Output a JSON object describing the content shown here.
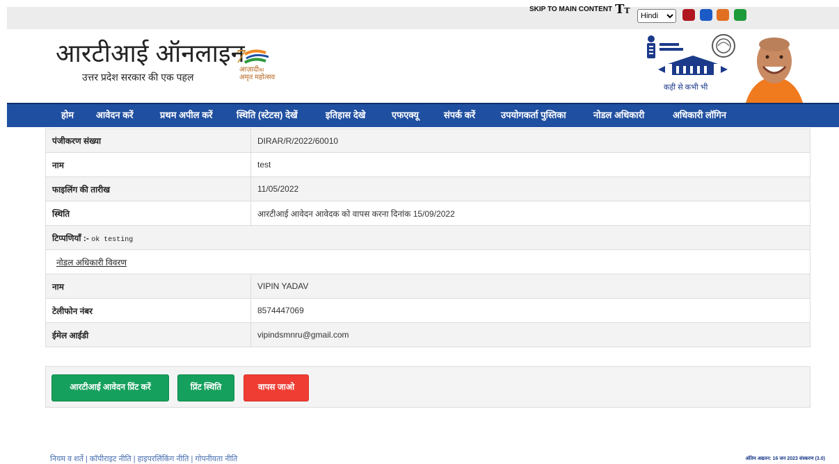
{
  "topbar": {
    "skip_label": "SKIP TO MAIN CONTENT",
    "text_size_glyph_big": "T",
    "text_size_glyph_small": "T",
    "language_selected": "Hindi",
    "theme_colors": [
      "#b0161f",
      "#1c5bc6",
      "#e07020",
      "#1d9a3a"
    ]
  },
  "header": {
    "site_title": "आरटीआई ऑनलाइन",
    "site_subtitle": "उत्तर प्रदेश सरकार की एक पहल",
    "azadi_line1": "आज़ादी",
    "azadi_line1_small": "का",
    "azadi_line2": "अमृत महोत्सव",
    "rti_tagline": "कही से कभी भी"
  },
  "nav": {
    "items": [
      {
        "label": "होम"
      },
      {
        "label": "आवेदन करें"
      },
      {
        "label": "प्रथम अपील करें"
      },
      {
        "label": "स्थिति (स्टेटस) देखें"
      },
      {
        "label": "इतिहास देखे"
      },
      {
        "label": "एफएक्यू"
      },
      {
        "label": "संपर्क करें"
      },
      {
        "label": "उपयोगकर्ता पुस्तिका"
      },
      {
        "label": "नोडल अधिकारी"
      },
      {
        "label": "अधिकारी लॉगिन"
      }
    ]
  },
  "details": {
    "registration_label": "पंजीकरण संख्या",
    "registration_value": "DIRAR/R/2022/60010",
    "name_label": "नाम",
    "name_value": "test",
    "filing_date_label": "फाइलिंग की तारीख",
    "filing_date_value": "11/05/2022",
    "status_label": "स्थिति",
    "status_value": "आरटीआई आवेदन आवेदक को वापस करना दिनांक 15/09/2022",
    "remarks_label": "टिप्पणियाँ :-",
    "remarks_value": "ok testing",
    "nodal_section_title": "नोडल अधिकारी विवरण",
    "nodal_name_label": "नाम",
    "nodal_name_value": "VIPIN YADAV",
    "phone_label": "टेलीफोन नंबर",
    "phone_value": "8574447069",
    "email_label": "ईमेल आईडी",
    "email_value": "vipindsmnru@gmail.com"
  },
  "buttons": {
    "print_application": "आरटीआई आवेदन प्रिंट करें",
    "print_status": "प्रिंट स्थिति",
    "go_back": "वापस जाओ"
  },
  "footer": {
    "terms": "नियम व शर्ते",
    "copyright": "कॉपीराइट नीति",
    "hyperlink": "हाइपरलिंकिंग नीति",
    "privacy": "गोपनीयता नीति",
    "separator": " | ",
    "last_updated": "अंतिम अद्यतन: 16 जन 2023 संस्करण (3.0)"
  }
}
